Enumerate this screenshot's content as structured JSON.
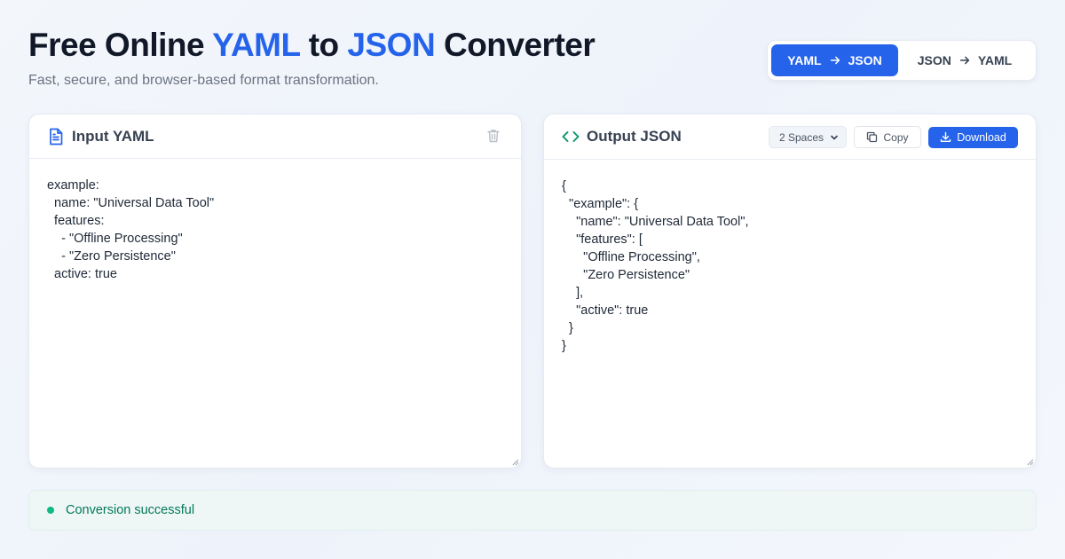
{
  "header": {
    "title_pre": "Free Online ",
    "title_accent1": "YAML",
    "title_mid": " to ",
    "title_accent2": "JSON",
    "title_post": " Converter",
    "subtitle": "Fast, secure, and browser-based format transformation."
  },
  "mode_toggle": {
    "active": {
      "from": "YAML",
      "to": "JSON"
    },
    "inactive": {
      "from": "JSON",
      "to": "YAML"
    }
  },
  "input_panel": {
    "title": "Input YAML",
    "icon": "file-text-icon",
    "content": "example:\n  name: \"Universal Data Tool\"\n  features:\n    - \"Offline Processing\"\n    - \"Zero Persistence\"\n  active: true"
  },
  "output_panel": {
    "title": "Output JSON",
    "icon": "code-icon",
    "indent_select": "2 Spaces",
    "copy_label": "Copy",
    "download_label": "Download",
    "content": "{\n  \"example\": {\n    \"name\": \"Universal Data Tool\",\n    \"features\": [\n      \"Offline Processing\",\n      \"Zero Persistence\"\n    ],\n    \"active\": true\n  }\n}"
  },
  "status": {
    "text": "Conversion successful",
    "color": "#10b981"
  },
  "colors": {
    "accent": "#2563eb",
    "success_text": "#047857"
  }
}
